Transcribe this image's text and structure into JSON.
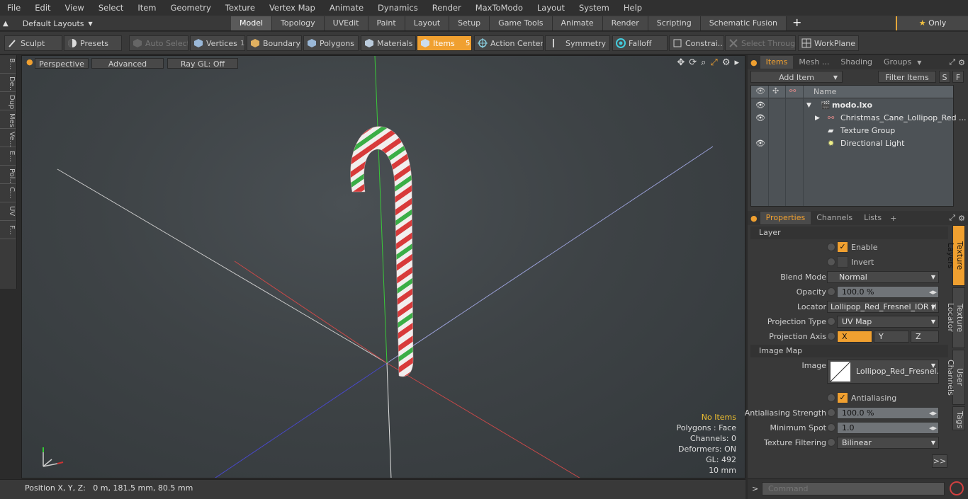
{
  "menu": [
    "File",
    "Edit",
    "View",
    "Select",
    "Item",
    "Geometry",
    "Texture",
    "Vertex Map",
    "Animate",
    "Dynamics",
    "Render",
    "MaxToModo",
    "Layout",
    "System",
    "Help"
  ],
  "layout_selector": "Default Layouts",
  "tabs": [
    "Model",
    "Topology",
    "UVEdit",
    "Paint",
    "Layout",
    "Setup",
    "Game Tools",
    "Animate",
    "Render",
    "Scripting",
    "Schematic Fusion"
  ],
  "only_label": "Only",
  "toolbar": {
    "sculpt": "Sculpt",
    "presets": "Presets",
    "auto_select": "Auto Select",
    "vertices": "Vertices",
    "vertices_count": "1",
    "boundary": "Boundary",
    "polygons": "Polygons",
    "materials": "Materials",
    "items": "Items",
    "items_count": "5",
    "action_center": "Action Center",
    "symmetry": "Symmetry",
    "falloff": "Falloff",
    "constraints": "Constrai...",
    "select_through": "Select Through",
    "workplane": "WorkPlane"
  },
  "left_tabs": [
    "B...",
    "De...",
    "Dup...",
    "Mes...",
    "Ve...",
    "E...",
    "Pol...",
    "C...",
    "UV",
    "F..."
  ],
  "viewport": {
    "perspective": "Perspective",
    "advanced": "Advanced",
    "raygl": "Ray GL: Off",
    "info": [
      "No Items",
      "Polygons : Face",
      "Channels: 0",
      "Deformers: ON",
      "GL: 492",
      "10 mm"
    ]
  },
  "status": "Position X, Y, Z:   0 m, 181.5 mm, 80.5 mm",
  "items_panel": {
    "tabs": [
      "Items",
      "Mesh ...",
      "Shading",
      "Groups"
    ],
    "add_item": "Add Item",
    "filter": "Filter Items",
    "s": "S",
    "f": "F",
    "name_header": "Name",
    "rows": [
      "modo.lxo",
      "Christmas_Cane_Lollipop_Red ...",
      "Texture Group",
      "Directional Light"
    ]
  },
  "props_panel": {
    "tabs": [
      "Properties",
      "Channels",
      "Lists"
    ],
    "layer_section": "Layer",
    "enable": "Enable",
    "invert": "Invert",
    "blend_mode_label": "Blend Mode",
    "blend_mode": "Normal",
    "opacity_label": "Opacity",
    "opacity": "100.0 %",
    "locator_label": "Locator",
    "locator": "Lollipop_Red_Fresnel_IOR (I ...",
    "projection_type_label": "Projection Type",
    "projection_type": "UV Map",
    "projection_axis_label": "Projection Axis",
    "axis_x": "X",
    "axis_y": "Y",
    "axis_z": "Z",
    "image_map_section": "Image Map",
    "image_label": "Image",
    "image": "Lollipop_Red_Fresnel...",
    "antialiasing": "Antialiasing",
    "aa_strength_label": "Antialiasing Strength",
    "aa_strength": "100.0 %",
    "min_spot_label": "Minimum Spot",
    "min_spot": "1.0",
    "tex_filter_label": "Texture Filtering",
    "tex_filter": "Bilinear",
    "more": ">>",
    "vtabs": [
      "Texture Layers",
      "Texture Locator",
      "User Channels",
      "Tags"
    ]
  },
  "command_placeholder": "Command"
}
